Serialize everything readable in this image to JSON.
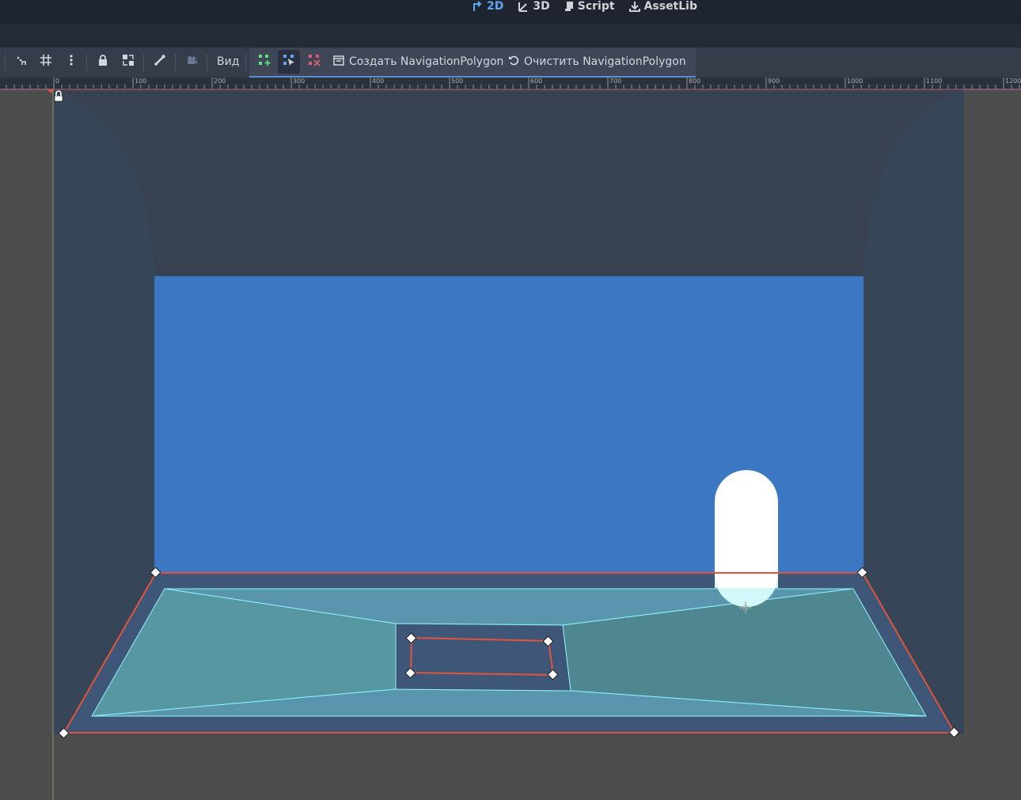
{
  "workspace_tabs": [
    {
      "label": "2D",
      "icon": "2d-workspace-icon",
      "active": true
    },
    {
      "label": "3D",
      "icon": "3d-workspace-icon",
      "active": false
    },
    {
      "label": "Script",
      "icon": "script-icon",
      "active": false
    },
    {
      "label": "AssetLib",
      "icon": "assetlib-download-icon",
      "active": false
    }
  ],
  "toolbar": {
    "view_menu": "Вид",
    "create_navpoly": "Создать NavigationPolygon",
    "clear_navpoly": "Очистить NavigationPolygon"
  },
  "ruler": {
    "labels": [
      "0",
      "100",
      "200",
      "300",
      "400",
      "500",
      "600",
      "700",
      "800",
      "900",
      "1000",
      "1100",
      "1200"
    ]
  },
  "colors": {
    "accent": "#5ea8f2",
    "sky": "#3b77c3",
    "outline": "#e0553b",
    "navmesh": "#5ac4c0",
    "navmesh_edge": "#8ff2ff"
  }
}
